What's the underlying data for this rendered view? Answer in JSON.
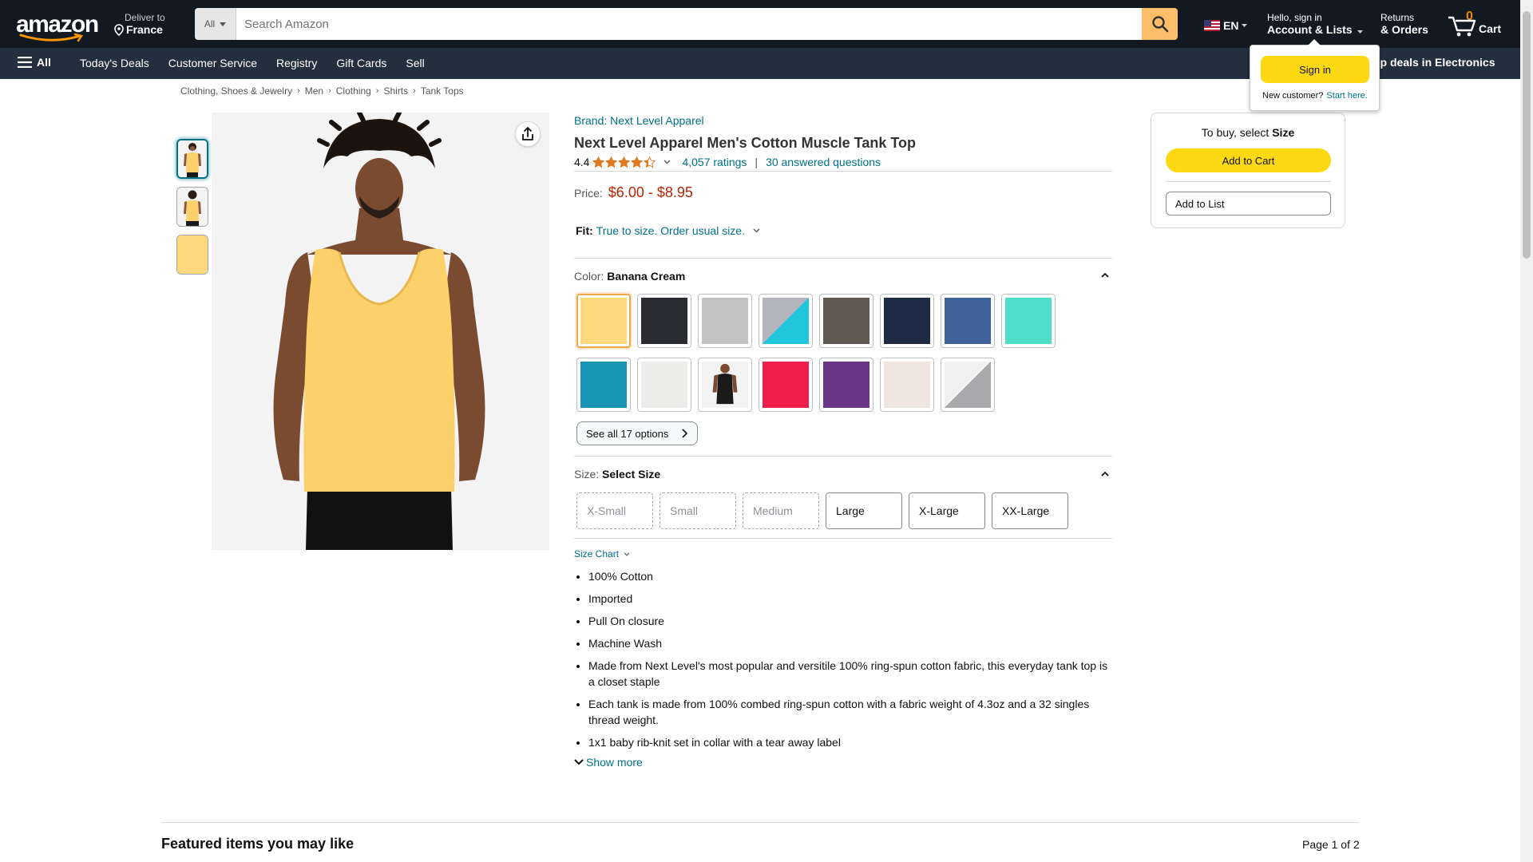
{
  "header": {
    "logo_text": "amazon",
    "deliver_line1": "Deliver to",
    "deliver_line2": "France",
    "search_category": "All",
    "search_placeholder": "Search Amazon",
    "language": "EN",
    "account_line1": "Hello, sign in",
    "account_line2": "Account & Lists",
    "returns_line1": "Returns",
    "returns_line2": "& Orders",
    "cart_count": "0",
    "cart_label": "Cart"
  },
  "subnav": {
    "all_label": "All",
    "links": [
      "Today's Deals",
      "Customer Service",
      "Registry",
      "Gift Cards",
      "Sell"
    ],
    "promo": "op deals in Electronics"
  },
  "signin_popup": {
    "button": "Sign in",
    "new_customer": "New customer?",
    "start_here": "Start here."
  },
  "breadcrumb": [
    "Clothing, Shoes & Jewelry",
    "Men",
    "Clothing",
    "Shirts",
    "Tank Tops"
  ],
  "product": {
    "brand": "Brand: Next Level Apparel",
    "title": "Next Level Apparel Men's Cotton Muscle Tank Top",
    "rating": "4.4",
    "star_rating_value": 4.4,
    "ratings_count": "4,057 ratings",
    "divider": "|",
    "answered": "30 answered questions",
    "price_label": "Price:",
    "price": "$6.00 - $8.95",
    "fit_label": "Fit:",
    "fit_value": "True to size. Order usual size.",
    "color_label": "Color:",
    "color_value": "Banana Cream",
    "swatches": [
      {
        "name": "banana-cream",
        "color": "#fdd97e",
        "selected": true
      },
      {
        "name": "black",
        "color": "#2a2b30"
      },
      {
        "name": "heather-gray",
        "color": "#c3c3c3"
      },
      {
        "name": "turquoise-heather-split",
        "color": "#22c6dc",
        "color2": "#b5b5bd"
      },
      {
        "name": "military-green",
        "color": "#5e5a4f"
      },
      {
        "name": "midnight-navy",
        "color": "#1f2b45"
      },
      {
        "name": "indigo",
        "color": "#41619a"
      },
      {
        "name": "tahiti-blue",
        "color": "#4dddc8"
      },
      {
        "name": "teal",
        "color": "#1b95b6"
      },
      {
        "name": "white",
        "color": "#ececea"
      },
      {
        "name": "black-tank-photo",
        "color": "#1a1a1a"
      },
      {
        "name": "red",
        "color": "#f21f4d"
      },
      {
        "name": "purple",
        "color": "#6b3585"
      },
      {
        "name": "natural",
        "color": "#f1e6df"
      },
      {
        "name": "heather-white-split",
        "color": "#a9a9ab",
        "color2": "#f2f2f2"
      }
    ],
    "see_all": "See all 17 options",
    "size_label": "Size:",
    "size_value": "Select Size",
    "sizes": [
      {
        "label": "X-Small",
        "available": false
      },
      {
        "label": "Small",
        "available": false
      },
      {
        "label": "Medium",
        "available": false
      },
      {
        "label": "Large",
        "available": true
      },
      {
        "label": "X-Large",
        "available": true
      },
      {
        "label": "XX-Large",
        "available": true
      }
    ],
    "size_chart": "Size Chart",
    "bullets": [
      "100% Cotton",
      "Imported",
      "Pull On closure",
      "Machine Wash",
      "Made from Next Level's most popular and versitile 100% ring-spun cotton fabric, this everyday tank top is a closet staple",
      "Each tank is made from 100% combed ring-spun cotton with a fabric weight of 4.3oz and a 32 singles thread weight.",
      "1x1 baby rib-knit set in collar with a tear away label"
    ],
    "show_more": "Show more"
  },
  "buybox": {
    "title_prefix": "To buy, select",
    "title_bold": "Size",
    "add_to_cart": "Add to Cart",
    "add_to_list": "Add to List"
  },
  "featured": {
    "title": "Featured items you may like",
    "page": "Page 1 of 2"
  },
  "colors": {
    "nav_dark": "#131921",
    "subnav": "#232f3e",
    "link": "#007185",
    "price": "#b12704",
    "button_yellow": "#ffd814",
    "search_orange": "#febd69",
    "star": "#de7921"
  }
}
